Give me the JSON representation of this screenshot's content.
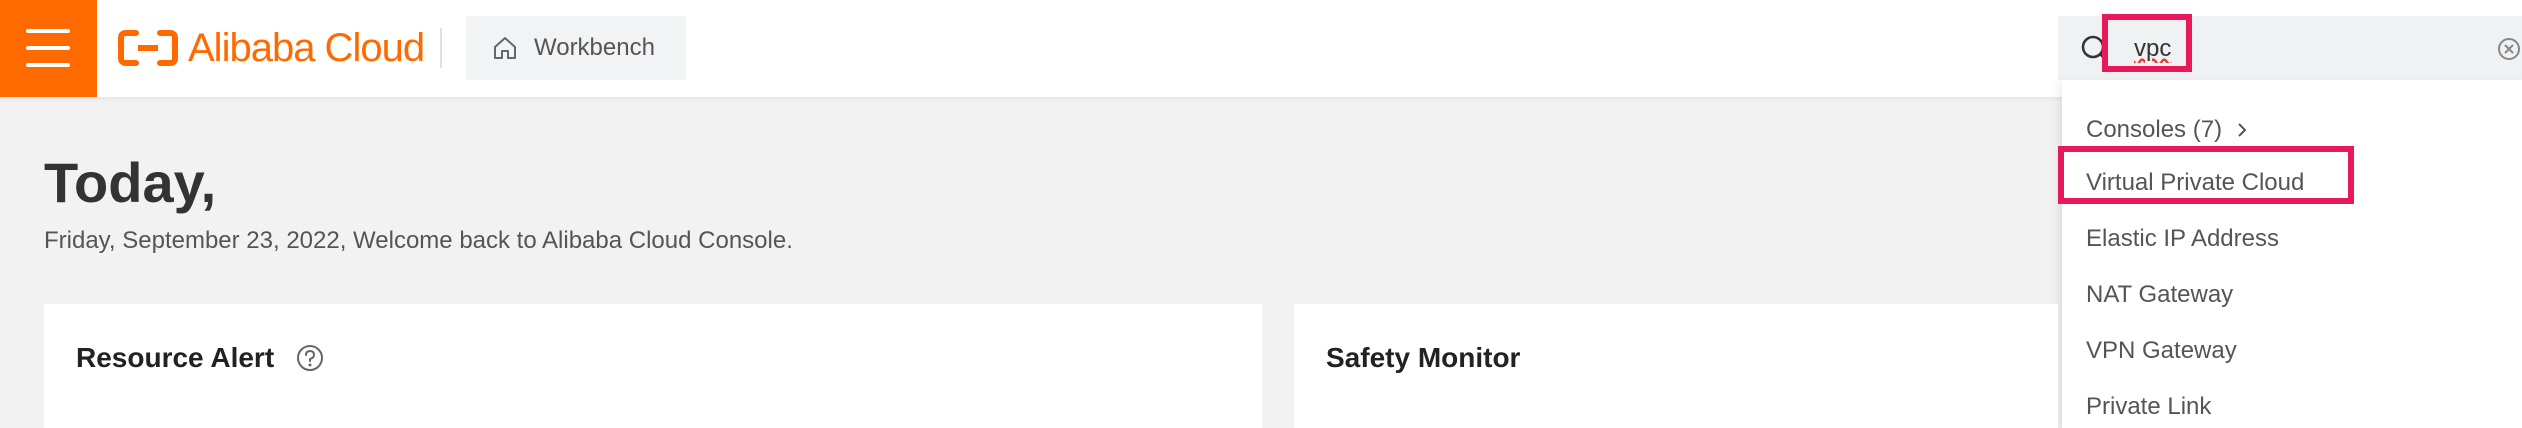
{
  "header": {
    "logo_text": "Alibaba Cloud",
    "workbench_label": "Workbench"
  },
  "search": {
    "value": "vpc"
  },
  "dropdown": {
    "group_label": "Consoles (7)",
    "items": [
      "Virtual Private Cloud",
      "Elastic IP Address",
      "NAT Gateway",
      "VPN Gateway",
      "Private Link"
    ]
  },
  "greeting": {
    "title": "Today,",
    "subtitle": "Friday, September 23, 2022, Welcome back to Alibaba Cloud Console."
  },
  "cards": [
    {
      "title": "Resource Alert"
    },
    {
      "title": "Safety Monitor"
    }
  ],
  "colors": {
    "brand": "#ff6a00",
    "highlight": "#e8195a"
  }
}
